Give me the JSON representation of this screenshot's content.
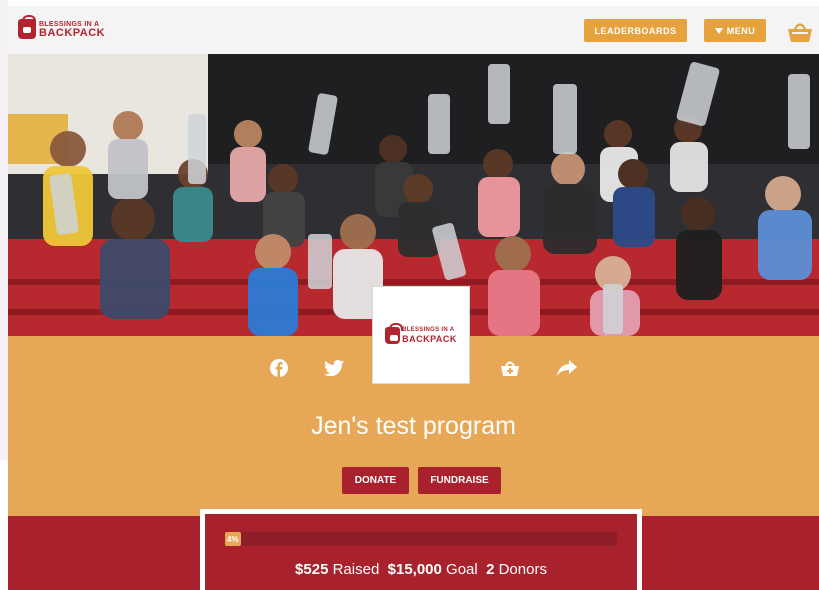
{
  "header": {
    "logo_line1": "BLESSINGS IN A",
    "logo_line2": "BACKPACK",
    "leaderboards_label": "LEADERBOARDS",
    "menu_label": "MENU",
    "menu_icon": "caret-down-icon",
    "cart_icon": "basket-icon"
  },
  "org_card": {
    "logo_line1": "BLESSINGS IN A",
    "logo_line2": "BACKPACK"
  },
  "share_icons": [
    "facebook-icon",
    "twitter-icon",
    "basket-icon",
    "share-arrow-icon"
  ],
  "program": {
    "title": "Jen's test program",
    "donate_label": "DONATE",
    "fundraise_label": "FUNDRAISE"
  },
  "stats": {
    "progress_percent": 4,
    "progress_label": "4%",
    "raised_amount": "$525",
    "raised_label": "Raised",
    "goal_amount": "$15,000",
    "goal_label": "Goal",
    "donors_count": "2",
    "donors_label": "Donors"
  },
  "colors": {
    "brand_red": "#a9212d",
    "brand_orange": "#e6a857",
    "button_orange": "#e6a23c"
  }
}
